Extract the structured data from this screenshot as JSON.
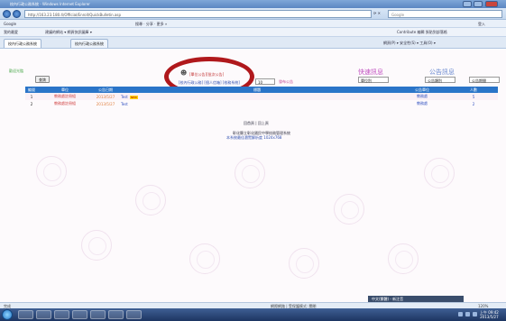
{
  "browser": {
    "window_title": "校內行政公務系統 - Windows Internet Explorer",
    "address": "http://163.23.180.4/Official/Enroll/QuickBulletin.asp",
    "search_placeholder": "Google",
    "toolbar1_left": "Google",
    "toolbar1_items": "搜尋 · 分享 · 更多 »",
    "toolbar1_right": "登入",
    "toolbar2_left": "我的最愛",
    "toolbar2_items": "建議的網站 ▾   網頁快訊圖庫 ▾",
    "toolbar2_right": "Contribute  編輯  張貼到部落格",
    "tabs": [
      "校內行政公務系統",
      "校內行政公務系統"
    ],
    "tab_right": "網頁(P) ▾  安全性(S) ▾  工具(O) ▾"
  },
  "page": {
    "login_label": "歡迎光臨",
    "search_button": "查詢",
    "link_top": "[單位公告][批次公告]",
    "link_bottom": "[校內行政公務] [個人信箱] [校務系統]",
    "middle_select": "10",
    "middle_link": "發布公告",
    "quick_title": "快速訊息",
    "quick_select": "單位別",
    "announce_title": "公告訊息",
    "announce_select1": "公告類別",
    "announce_select2": "公告期間",
    "table": {
      "headers": [
        "編號",
        "單位",
        "公告日期",
        "標題",
        "公告單位",
        "人數"
      ],
      "rows": [
        {
          "no": "1",
          "unit": "教務處註冊組",
          "date": "2013/5/27",
          "title": "Test",
          "badge": "NEW",
          "owner": "教務處",
          "count": "5"
        },
        {
          "no": "2",
          "unit": "教務處註冊組",
          "date": "2013/5/27",
          "title": "Test",
          "badge": "",
          "owner": "教務處",
          "count": "2"
        }
      ]
    },
    "footer_line1": "回首頁 | 回上頁",
    "footer_line2": "彰化縣立彰化國民中學校務管理系統",
    "footer_line3": "本系統最佳瀏覽解析度 1024x768"
  },
  "status": {
    "left": "完成",
    "zone": "網際網路 | 受保護模式: 關閉",
    "zoom": "120%"
  },
  "ime": {
    "label": "中文(繁體) - 新注音"
  },
  "taskbar": {
    "time": "上午 09:42",
    "date": "2013/5/27"
  }
}
